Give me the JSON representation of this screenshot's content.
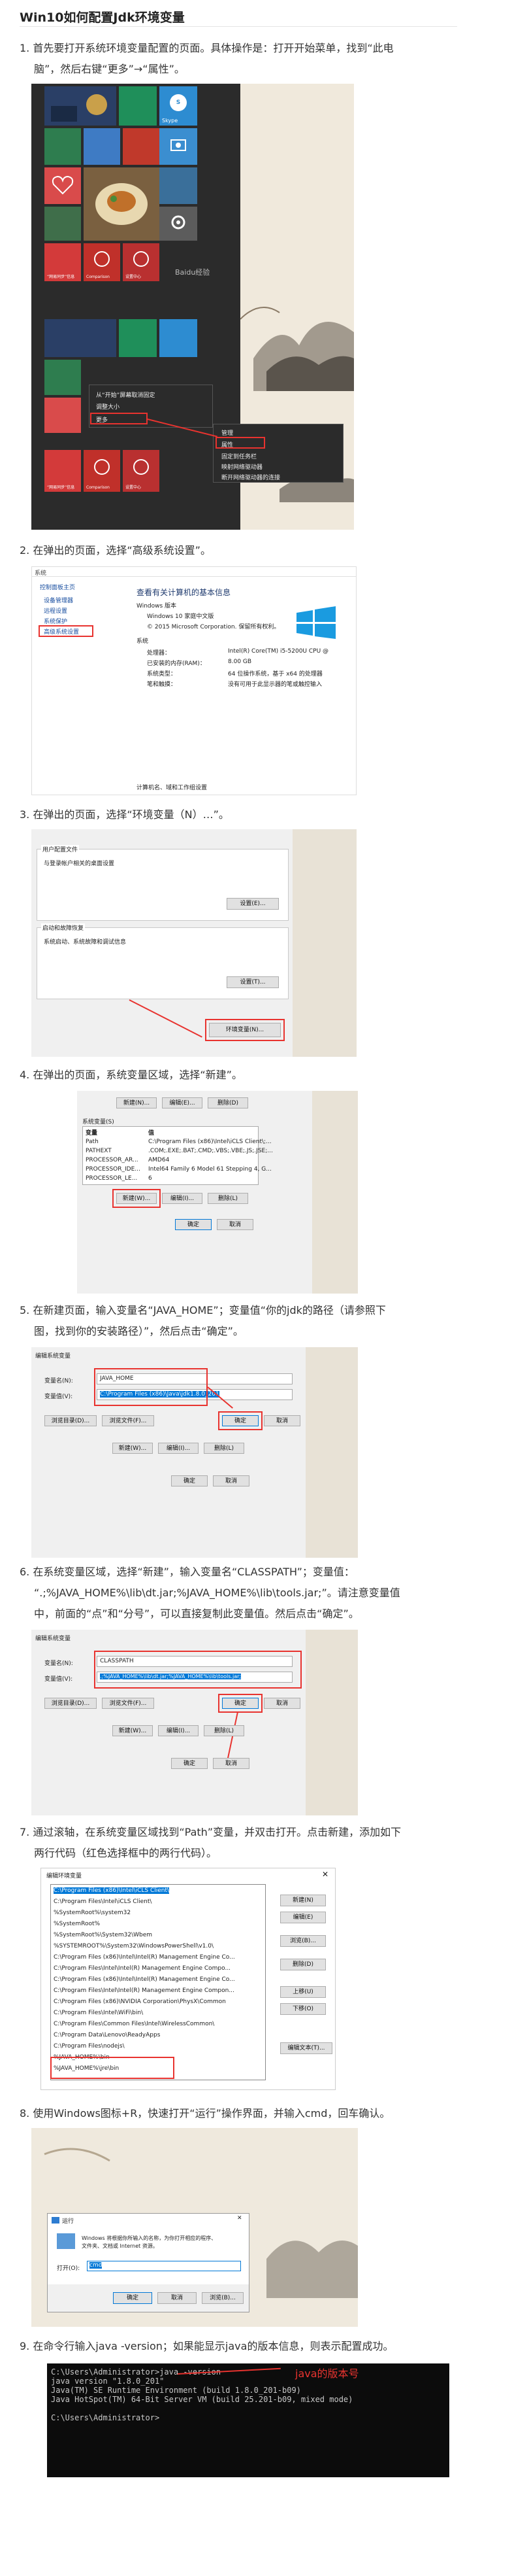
{
  "title": "Win10如何配置Jdk环境变量",
  "steps": [
    {
      "num": "1.",
      "line1": "首先要打开系统环境变量配置的页面。具体操作是：打开开始菜单，找到“此电",
      "line2": "脑”，然后右键“更多”→“属性”。"
    },
    {
      "num": "2.",
      "line1": "在弹出的页面，选择“高级系统设置”。"
    },
    {
      "num": "3.",
      "line1": "在弹出的页面，选择“环境变量（N）…”。"
    },
    {
      "num": "4.",
      "line1": "在弹出的页面，系统变量区域，选择“新建”。"
    },
    {
      "num": "5.",
      "line1": "在新建页面，输入变量名“JAVA_HOME”；变量值“你的jdk的路径（请参照下",
      "line2": "图，找到你的安装路径）”，然后点击“确定”。"
    },
    {
      "num": "6.",
      "line1": "在系统变量区域，选择“新建”，输入变量名“CLASSPATH”；变量值：",
      "line2": "“.;%JAVA_HOME%\\lib\\dt.jar;%JAVA_HOME%\\lib\\tools.jar;”。请注意变量值",
      "line3": "中，前面的“点”和“分号”，可以直接复制此变量值。然后点击“确定”。"
    },
    {
      "num": "7.",
      "line1": "通过滚轴，在系统变量区域找到“Path”变量，并双击打开。点击新建，添加如下",
      "line2": "两行代码（红色选择框中的两行代码）。"
    },
    {
      "num": "8.",
      "line1": "使用Windows图标+R，快速打开“运行”操作界面，并输入cmd，回车确认。"
    },
    {
      "num": "9.",
      "line1": "在命令行输入java -version；如果能显示java的版本信息，则表示配置成功。"
    }
  ],
  "shot1": {
    "tiles_top": [
      "照片",
      "邮件",
      "Skype"
    ],
    "tiles_mid": [
      "“网易云”",
      "健康",
      "食物和美食",
      "设置"
    ],
    "tiles_row3": [
      "“网易同步”信息",
      "Comparison",
      "设置中心"
    ],
    "tiles_low": [
      "“网易同步”信息",
      "Comparison",
      "设置中心"
    ],
    "top_labels": [
      "此电脑",
      "Skype"
    ],
    "menu": [
      "从“开始”屏幕取消固定",
      "调整大小",
      "更多"
    ],
    "submenu": [
      "管理",
      "属性",
      "固定到任务栏",
      "映射网络驱动器",
      "断开网络驱动器的连接"
    ],
    "watermark": "Baidu经验"
  },
  "shot2": {
    "nav_title": "控制面板主页",
    "nav_items": [
      "设备管理器",
      "远程设置",
      "系统保护",
      "高级系统设置"
    ],
    "heading": "查看有关计算机的基本信息",
    "section1": "Windows 版本",
    "os": "Windows 10 家庭中文版",
    "copyright": "© 2015 Microsoft Corporation. 保留所有权利。",
    "section2": "系统",
    "rows": [
      [
        "处理器：",
        "Intel(R) Core(TM) i5-5200U CPU @"
      ],
      [
        "已安装的内存(RAM)：",
        "8.00 GB"
      ],
      [
        "系统类型：",
        "64 位操作系统，基于 x64 的处理器"
      ],
      [
        "笔和触摸：",
        "没有可用于此显示器的笔或触控输入"
      ]
    ],
    "footer": "计算机名、域和工作组设置",
    "topbar": "系统"
  },
  "shot3": {
    "g1": "用户配置文件",
    "g1_desc": "与登录帐户相关的桌面设置",
    "g2": "启动和故障恢复",
    "g2_desc": "系统启动、系统故障和调试信息",
    "btn_settings": "设置(E)...",
    "btn_settings2": "设置(T)...",
    "btn_env": "环境变量(N)..."
  },
  "shot4": {
    "top_buttons": [
      "新建(N)...",
      "编辑(E)...",
      "删除(D)"
    ],
    "group": "系统变量(S)",
    "col_var": "变量",
    "col_val": "值",
    "rows": [
      [
        "Path",
        "C:\\Program Files (x86)\\Intel\\iCLS Client\\;..."
      ],
      [
        "PATHEXT",
        ".COM;.EXE;.BAT;.CMD;.VBS;.VBE;.JS;.JSE;..."
      ],
      [
        "PROCESSOR_AR...",
        "AMD64"
      ],
      [
        "PROCESSOR_IDE...",
        "Intel64 Family 6 Model 61 Stepping 4, G..."
      ],
      [
        "PROCESSOR_LE...",
        "6"
      ]
    ],
    "bottom_buttons": [
      "新建(W)...",
      "编辑(I)...",
      "删除(L)"
    ],
    "ok": "确定",
    "cancel": "取消"
  },
  "shot5": {
    "dialog": "编辑系统变量",
    "name_label": "变量名(N):",
    "name_value": "JAVA_HOME",
    "value_label": "变量值(V):",
    "value_value": "C:\\Program Files (x86)\\Java\\jdk1.8.0_201",
    "browse_dir": "浏览目录(D)...",
    "browse_file": "浏览文件(F)...",
    "ok": "确定",
    "cancel": "取消",
    "bg_buttons": [
      "新建(W)...",
      "编辑(I)...",
      "删除(L)"
    ],
    "bg_ok": "确定",
    "bg_cancel": "取消"
  },
  "shot6": {
    "dialog": "编辑系统变量",
    "name_label": "变量名(N):",
    "name_value": "CLASSPATH",
    "value_label": "变量值(V):",
    "value_value": ".;%JAVA_HOME%\\lib\\dt.jar;%JAVA_HOME%\\lib\\tools.jar;",
    "browse_dir": "浏览目录(D)...",
    "browse_file": "浏览文件(F)...",
    "ok": "确定",
    "cancel": "取消",
    "bg_buttons": [
      "新建(W)...",
      "编辑(I)...",
      "删除(L)"
    ],
    "bg_ok": "确定",
    "bg_cancel": "取消"
  },
  "shot7": {
    "dialog": "编辑环境变量",
    "entries": [
      "C:\\Program Files (x86)\\Intel\\iCLS Client\\",
      "C:\\Program Files\\Intel\\iCLS Client\\",
      "%SystemRoot%\\system32",
      "%SystemRoot%",
      "%SystemRoot%\\System32\\Wbem",
      "%SYSTEMROOT%\\System32\\WindowsPowerShell\\v1.0\\",
      "C:\\Program Files (x86)\\Intel\\Intel(R) Management Engine Co...",
      "C:\\Program Files\\Intel\\Intel(R) Management Engine Compo...",
      "C:\\Program Files (x86)\\Intel\\Intel(R) Management Engine Co...",
      "C:\\Program Files\\Intel\\Intel(R) Management Engine Compon...",
      "C:\\Program Files (x86)\\NVIDIA Corporation\\PhysX\\Common",
      "C:\\Program Files\\Intel\\WiFi\\bin\\",
      "C:\\Program Files\\Common Files\\Intel\\WirelessCommon\\",
      "C:\\Program Data\\Lenovo\\ReadyApps",
      "C:\\Program Files\\nodejs\\",
      "%JAVA_HOME%\\bin",
      "%JAVA_HOME%\\jre\\bin"
    ],
    "buttons": [
      "新建(N)",
      "编辑(E)",
      "浏览(B)...",
      "删除(D)",
      "上移(U)",
      "下移(O)",
      "编辑文本(T)..."
    ]
  },
  "shot8": {
    "dialog": "运行",
    "desc1": "Windows 将根据你所输入的名称，为你打开相应的程序、",
    "desc2": "文件夹、文档或 Internet 资源。",
    "open_label": "打开(O):",
    "open_value": "cmd",
    "ok": "确定",
    "cancel": "取消",
    "browse": "浏览(B)..."
  },
  "shot9": {
    "lines": [
      "C:\\Users\\Administrator>java -version",
      "java version \"1.8.0_201\"",
      "Java(TM) SE Runtime Environment (build 1.8.0_201-b09)",
      "Java HotSpot(TM) 64-Bit Server VM (build 25.201-b09, mixed mode)",
      "",
      "C:\\Users\\Administrator>"
    ],
    "note": "java的版本号"
  },
  "colors": {
    "red": "#e8332f",
    "win_blue": "#0078d7",
    "tile_red": "#d33a3a"
  }
}
